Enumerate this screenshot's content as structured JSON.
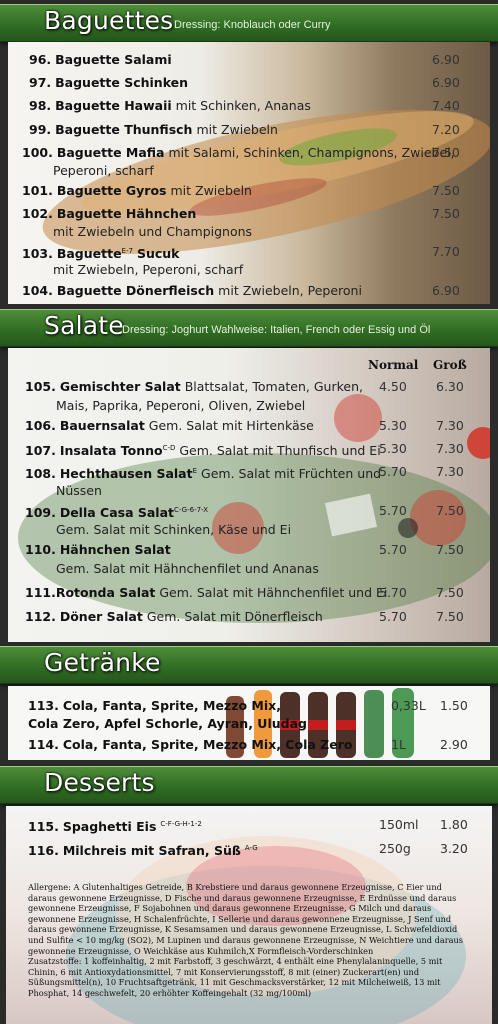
{
  "sections": {
    "baguettes": {
      "title": "Baguettes",
      "subtitle": "Dressing: Knoblauch oder Curry",
      "items": [
        {
          "num": "96.",
          "name": "Baguette Salami",
          "desc": "",
          "desc2": "",
          "price": "6.90"
        },
        {
          "num": "97.",
          "name": "Baguette Schinken",
          "desc": "",
          "desc2": "",
          "price": "6.90"
        },
        {
          "num": "98.",
          "name": "Baguette Hawaii",
          "desc": "mit Schinken, Ananas",
          "desc2": "",
          "price": "7.40"
        },
        {
          "num": "99.",
          "name": "Baguette Thunfisch",
          "desc": "mit Zwiebeln",
          "desc2": "",
          "price": "7.20"
        },
        {
          "num": "100.",
          "name": "Baguette Mafia",
          "desc": "mit Salami, Schinken, Champignons, Zwiebel,",
          "desc2": "Peperoni, scharf",
          "price": "7.50"
        },
        {
          "num": "101.",
          "name": "Baguette Gyros",
          "desc": "mit Zwiebeln",
          "desc2": "",
          "price": "7.50"
        },
        {
          "num": "102.",
          "name": "Baguette Hähnchen",
          "desc": "",
          "desc2": "mit Zwiebeln und Champignons",
          "price": "7.50"
        },
        {
          "num": "103.",
          "name": "Baguette",
          "sup": "E-7",
          "name2": "Sucuk",
          "desc": "",
          "desc2": "mit Zwiebeln, Peperoni, scharf",
          "price": "7.70"
        },
        {
          "num": "104.",
          "name": "Baguette Dönerfleisch",
          "desc": "mit Zwiebeln, Peperoni",
          "desc2": "",
          "price": "6.90"
        }
      ]
    },
    "salate": {
      "title": "Salate",
      "subtitle": "Dressing: Joghurt Wahlweise: Italien, French oder Essig und Öl",
      "col_normal": "Normal",
      "col_gross": "Groß",
      "items": [
        {
          "num": "105.",
          "name": "Gemischter Salat",
          "desc": "Blattsalat, Tomaten, Gurken,",
          "desc2": "Mais, Paprika, Peperoni, Oliven, Zwiebel",
          "normal": "4.50",
          "gross": "6.30"
        },
        {
          "num": "106.",
          "name": "Bauernsalat",
          "desc": "Gem. Salat mit Hirtenkäse",
          "desc2": "",
          "normal": "5.30",
          "gross": "7.30"
        },
        {
          "num": "107.",
          "name": "Insalata Tonno",
          "sup": "C-D",
          "desc": "Gem. Salat mit Thunfisch und Ei",
          "desc2": "",
          "normal": "5.30",
          "gross": "7.30"
        },
        {
          "num": "108.",
          "name": "Hechthausen Salat",
          "sup": "E",
          "desc": "Gem. Salat mit Früchten und",
          "desc2": "Nüssen",
          "normal": "5.70",
          "gross": "7.30"
        },
        {
          "num": "109.",
          "name": "Della Casa Salat",
          "sup": "C-G-6-7-X",
          "desc": "",
          "desc2": "Gem. Salat mit Schinken, Käse und Ei",
          "normal": "5.70",
          "gross": "7.50"
        },
        {
          "num": "110.",
          "name": "Hähnchen Salat",
          "desc": "",
          "desc2": "Gem. Salat mit Hähnchenfilet und Ananas",
          "normal": "5.70",
          "gross": "7.50"
        },
        {
          "num": "111.",
          "name": "Rotonda Salat",
          "desc": "Gem. Salat mit Hähnchenfilet und Ei",
          "desc2": "",
          "normal": "5.70",
          "gross": "7.50"
        },
        {
          "num": "112.",
          "name": "Döner Salat",
          "desc": "Gem. Salat mit Dönerfleisch",
          "desc2": "",
          "normal": "5.70",
          "gross": "7.50"
        }
      ]
    },
    "getraenke": {
      "title": "Getränke",
      "items": [
        {
          "num": "113.",
          "name": "Cola, Fanta, Sprite, Mezzo Mix,",
          "name2": "Cola Zero, Apfel Schorle, Ayran, Uludag",
          "size": "0,33L",
          "price": "1.50"
        },
        {
          "num": "114.",
          "name": "Cola, Fanta, Sprite, Mezzo Mix, Cola Zero",
          "name2": "",
          "size": "1L",
          "price": "2.90"
        }
      ]
    },
    "desserts": {
      "title": "Desserts",
      "items": [
        {
          "num": "115.",
          "name": "Spaghetti Eis",
          "sup": "C-F-G-H-1-2",
          "size": "150ml",
          "price": "1.80"
        },
        {
          "num": "116.",
          "name": "Milchreis mit Safran, Süß",
          "sup": "A-G",
          "size": "250g",
          "price": "3.20"
        }
      ]
    }
  },
  "allergen_text": "Allergene: A Glutenhaltiges Getreide, B Krebstiere und daraus gewonnene Erzeugnisse, C Eier und daraus gewonnene Erzeugnisse, D Fische und daraus gewonnene Erzeugnisse, E Erdnüsse und daraus gewonnene Erzeugnisse, F Sojabohnen und daraus gewonnene Erzeugnisse, G Milch und daraus gewonnene Erzeugnisse, H Schalenfrüchte, I Sellerie und daraus gewonnene Erzeugnisse, J Senf und daraus gewonnene Erzeugnisse, K Sesamsamen und daraus gewonnene Erzeugnisse, L Schwefeldioxid und Sulfite < 10 mg/kg (SO2), M Lupinen und daraus gewonnene Erzeugnisse, N Weichtiere und daraus gewonnene Erzeugnisse, O Weichkäse aus Kuhmilch,X Formfleisch-Vorderschinken",
  "additives_text": "Zusatzstoffe: 1 koffeinhaltig, 2 mit Farbstoff, 3 geschwärzt, 4 enthält eine Phenylalaninquelle, 5 mit Chinin, 6 mit Antioxydationsmittel, 7 mit Konservierungsstoff, 8 mit (einer) Zuckerart(en) und Süßungsmittel(n), 10 Fruchtsaftgetränk, 11 mit Geschmacksverstärker, 12 mit Milcheiweiß, 13 mit Phosphat, 14 geschwefelt, 20 erhöhter Koffeingehalt (32 mg/100ml)",
  "colors": {
    "header_green": "#2f6b23",
    "panel_light": "#f2f2ee"
  }
}
